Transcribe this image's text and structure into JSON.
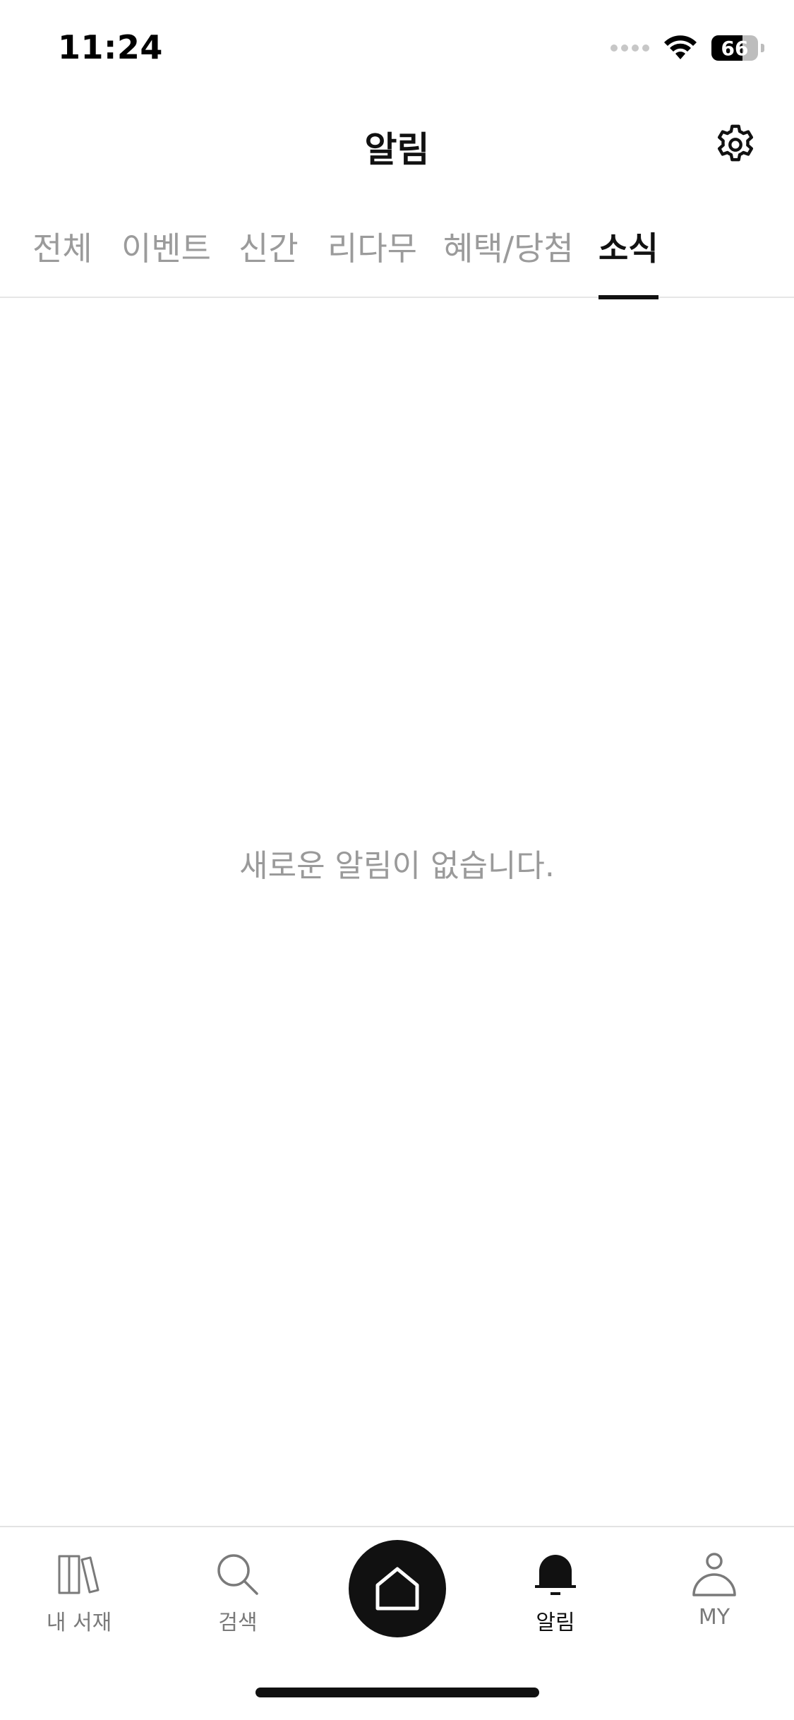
{
  "status_bar": {
    "time": "11:24",
    "battery_level": 66,
    "battery_text": "66"
  },
  "header": {
    "title": "알림",
    "settings_icon": "gear-icon"
  },
  "tabs": [
    {
      "label": "전체",
      "active": false
    },
    {
      "label": "이벤트",
      "active": false
    },
    {
      "label": "신간",
      "active": false
    },
    {
      "label": "리다무",
      "active": false
    },
    {
      "label": "혜택/당첨",
      "active": false
    },
    {
      "label": "소식",
      "active": true
    }
  ],
  "empty_state": {
    "message": "새로운 알림이 없습니다."
  },
  "bottom_nav": {
    "items": [
      {
        "label": "내 서재",
        "icon": "library-icon",
        "active": false
      },
      {
        "label": "검색",
        "icon": "search-icon",
        "active": false
      },
      {
        "label": "",
        "icon": "home-icon",
        "active": false
      },
      {
        "label": "알림",
        "icon": "bell-icon",
        "active": true
      },
      {
        "label": "MY",
        "icon": "person-icon",
        "active": false
      }
    ]
  },
  "colors": {
    "active_text": "#111111",
    "inactive_text": "#9b9b9b",
    "empty_text": "#9a9a9a",
    "home_button": "#111111"
  }
}
